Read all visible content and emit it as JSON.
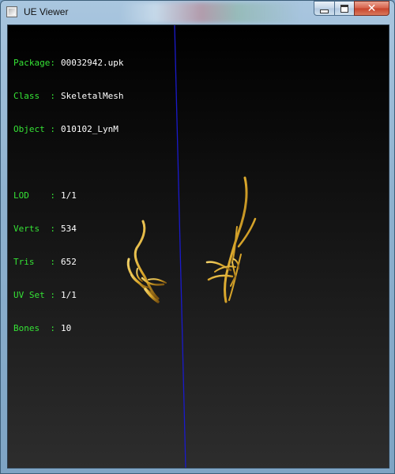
{
  "window": {
    "title": "UE Viewer"
  },
  "icons": {
    "app": "app-icon",
    "minimize": "minimize-icon",
    "maximize": "maximize-icon",
    "close": "close-icon"
  },
  "info": {
    "package": {
      "label": "Package:",
      "value": "00032942.upk"
    },
    "class": {
      "label": "Class  :",
      "value": "SkeletalMesh"
    },
    "object": {
      "label": "Object :",
      "value": "010102_LynM"
    },
    "lod": {
      "label": "LOD    :",
      "value": "1/1"
    },
    "verts": {
      "label": "Verts  :",
      "value": "534"
    },
    "tris": {
      "label": "Tris   :",
      "value": "652"
    },
    "uvset": {
      "label": "UV Set :",
      "value": "1/1"
    },
    "bones": {
      "label": "Bones  :",
      "value": "10"
    }
  },
  "colors": {
    "label": "#35e335",
    "value": "#ffffff",
    "axis": "#1a1acc",
    "mesh": "#d9a62a"
  }
}
